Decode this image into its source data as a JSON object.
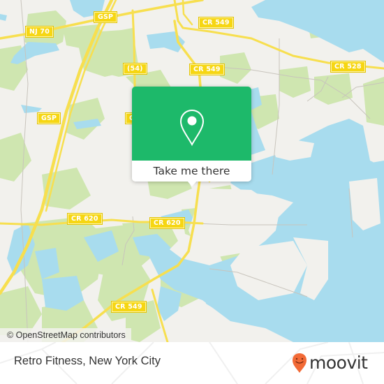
{
  "map": {
    "colors": {
      "land": "#f2f1ed",
      "water": "#a8dcee",
      "park": "#cfe6b0",
      "highway": "#f7df4f",
      "minor_road": "#c8c4bc",
      "shield_bg": "#f6d613"
    },
    "road_labels": [
      {
        "id": "gsp-top",
        "text": "GSP"
      },
      {
        "id": "nj70",
        "text": "NJ 70"
      },
      {
        "id": "cr549-top",
        "text": "CR 549"
      },
      {
        "id": "route54",
        "text": "(54)"
      },
      {
        "id": "cr549-mid",
        "text": "CR 549"
      },
      {
        "id": "cr528",
        "text": "CR 528"
      },
      {
        "id": "gsp-left",
        "text": "GSP"
      },
      {
        "id": "c-partial",
        "text": "C"
      },
      {
        "id": "cr620-left",
        "text": "CR 620"
      },
      {
        "id": "cr620-right",
        "text": "CR 620"
      },
      {
        "id": "cr549-bottom",
        "text": "CR 549"
      }
    ],
    "attribution": "© OpenStreetMap contributors"
  },
  "popup": {
    "icon": "map-pin-icon",
    "button_label": "Take me there",
    "color": "#1db96a"
  },
  "footer": {
    "place_name": "Retro Fitness, New York City",
    "brand": "moovit",
    "brand_icon": "moovit-smiley-pin-icon",
    "brand_color": "#f26a36"
  }
}
